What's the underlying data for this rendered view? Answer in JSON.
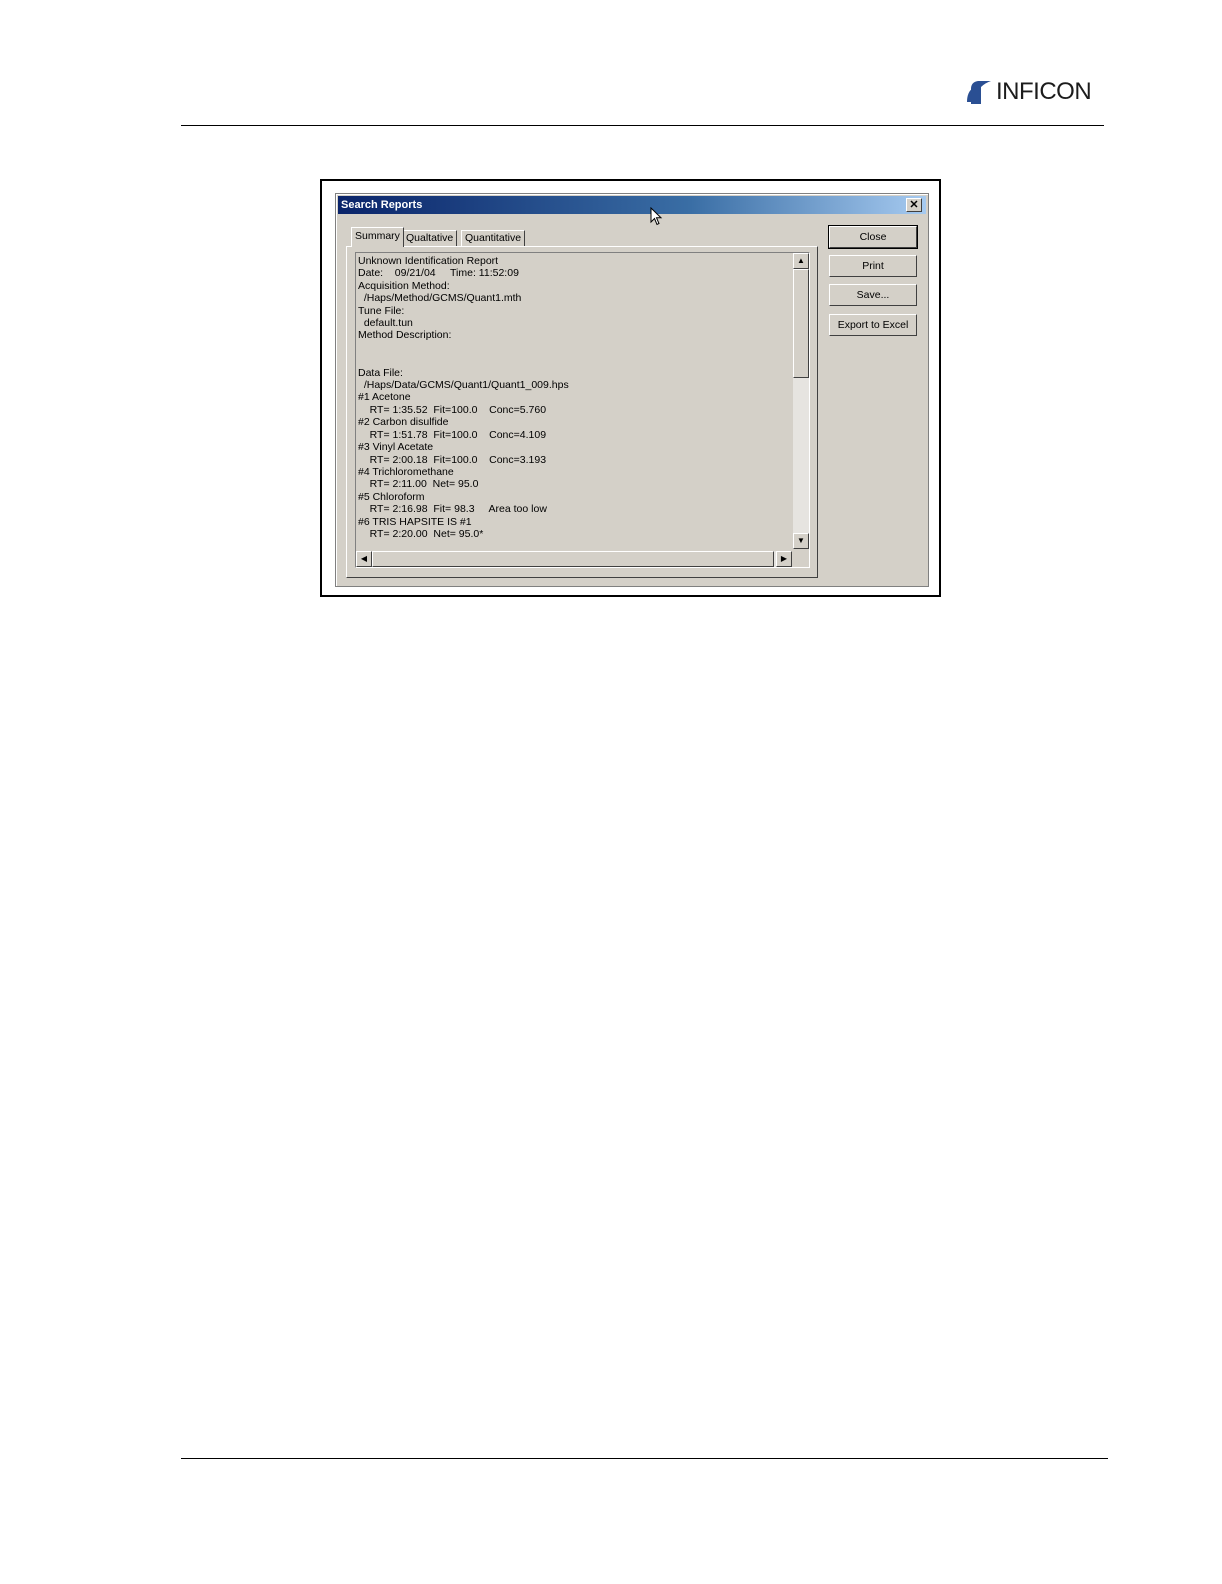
{
  "header": {
    "brand": "INFICON",
    "logo_color": "#2a4f93"
  },
  "dialog": {
    "title": "Search Reports",
    "close_glyph": "✕",
    "tabs": [
      {
        "label": "Summary",
        "active": true
      },
      {
        "label": "Qualtative",
        "active": false
      },
      {
        "label": "Quantitative",
        "active": false
      }
    ],
    "buttons": {
      "close": "Close",
      "print": "Print",
      "save": "Save...",
      "export": "Export to Excel"
    },
    "report_lines": [
      "Unknown Identification Report",
      "Date:    09/21/04     Time: 11:52:09",
      "Acquisition Method:",
      "  /Haps/Method/GCMS/Quant1.mth",
      "Tune File:",
      "  default.tun",
      "Method Description:",
      "",
      "",
      "Data File:",
      "  /Haps/Data/GCMS/Quant1/Quant1_009.hps",
      "#1 Acetone",
      "    RT= 1:35.52  Fit=100.0    Conc=5.760",
      "#2 Carbon disulfide",
      "    RT= 1:51.78  Fit=100.0    Conc=4.109",
      "#3 Vinyl Acetate",
      "    RT= 2:00.18  Fit=100.0    Conc=3.193",
      "#4 Trichloromethane",
      "    RT= 2:11.00  Net= 95.0",
      "#5 Chloroform",
      "    RT= 2:16.98  Fit= 98.3     Area too low",
      "#6 TRIS HAPSITE IS #1",
      "    RT= 2:20.00  Net= 95.0*"
    ],
    "scroll_glyphs": {
      "up": "▲",
      "down": "▼",
      "left": "◀",
      "right": "▶"
    }
  }
}
